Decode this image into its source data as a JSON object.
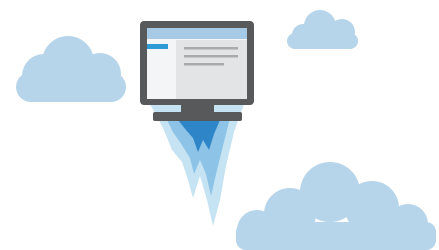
{
  "illustration": {
    "colors": {
      "background": "#ffffff",
      "cloud": "#b7d5ea",
      "monitor_frame": "#58595b",
      "screen_panel": "#e3e4e6",
      "screen_sidebar": "#f4f5f6",
      "title_bar": "#a6c9e6",
      "sidebar_selected": "#2e9bd5",
      "content_line": "#a8aaad",
      "flame_outer": "#c6e3f3",
      "flame_mid": "#8cc3e6",
      "flame_inner": "#2e86c8"
    }
  }
}
